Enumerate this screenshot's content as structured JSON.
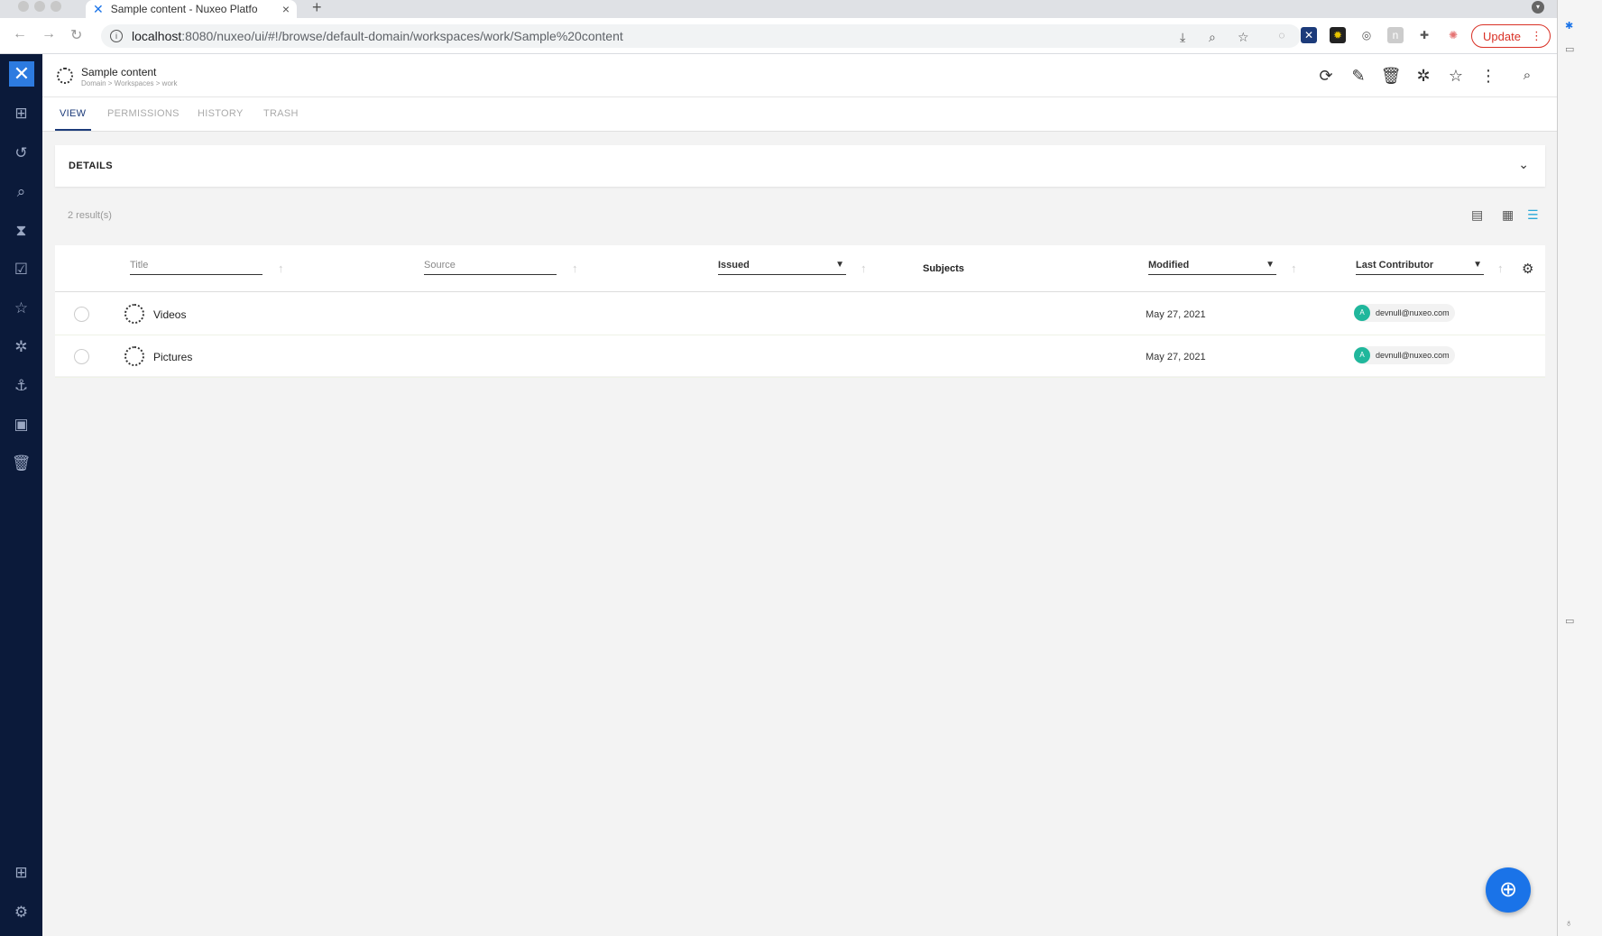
{
  "browser": {
    "tab_title": "Sample content - Nuxeo Platfo",
    "url_host": "localhost",
    "url_path": ":8080/nuxeo/ui/#!/browse/default-domain/workspaces/work/Sample%20content",
    "update_label": "Update"
  },
  "header": {
    "title": "Sample content",
    "breadcrumb": "Domain > Workspaces > work"
  },
  "tabs": {
    "view": "VIEW",
    "permissions": "PERMISSIONS",
    "history": "HISTORY",
    "trash": "TRASH"
  },
  "details": {
    "label": "DETAILS"
  },
  "results": {
    "count": "2 result(s)"
  },
  "columns": {
    "title": "Title",
    "source": "Source",
    "issued": "Issued",
    "subjects": "Subjects",
    "modified": "Modified",
    "last_contributor": "Last Contributor"
  },
  "rows": [
    {
      "title": "Videos",
      "modified": "May 27, 2021",
      "avatar": "A",
      "contributor": "devnull@nuxeo.com"
    },
    {
      "title": "Pictures",
      "modified": "May 27, 2021",
      "avatar": "A",
      "contributor": "devnull@nuxeo.com"
    }
  ],
  "colors": {
    "rail": "#0b1a3a",
    "accent": "#1a73e8",
    "avatar": "#20b79c"
  }
}
